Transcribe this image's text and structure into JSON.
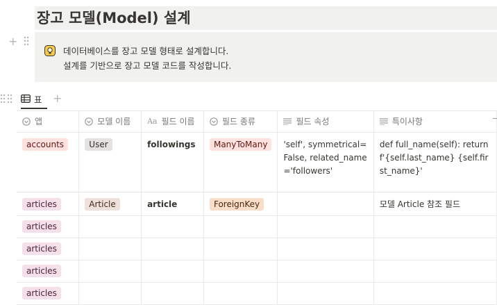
{
  "page": {
    "title": "장고 모델(Model) 설계"
  },
  "callout": {
    "icon": "lightbulb-emoji",
    "line1": "데이터베이스를 장고 모델 형태로 설계합니다.",
    "line2": "설계를 기반으로 장고 모델 코드를 작성합니다."
  },
  "view": {
    "tab_label": "표",
    "add_symbol": "+",
    "block_add_symbol": "+"
  },
  "table": {
    "headers": [
      {
        "label": "앱",
        "icon": "select-icon"
      },
      {
        "label": "모델 이름",
        "icon": "select-icon"
      },
      {
        "label": "필드 이름",
        "icon": "title-icon",
        "prefix": "Aa"
      },
      {
        "label": "필드 종류",
        "icon": "select-icon"
      },
      {
        "label": "필드 속성",
        "icon": "text-icon"
      },
      {
        "label": "특이사항",
        "icon": "text-icon"
      }
    ],
    "rows": [
      {
        "app": "accounts",
        "model": "User",
        "field_name": "followings",
        "field_type": "ManyToMany",
        "field_attr": "'self', symmetrical=False, related_name='followers'",
        "note": "def full_name(self): return f'{self.last_name} {self.first_name}'"
      },
      {
        "app": "articles",
        "model": "Article",
        "field_name": "article",
        "field_type": "ForeignKey",
        "field_attr": "",
        "note": "모델 Article 참조 필드"
      },
      {
        "app": "articles",
        "model": "",
        "field_name": "",
        "field_type": "",
        "field_attr": "",
        "note": ""
      },
      {
        "app": "articles",
        "model": "",
        "field_name": "",
        "field_type": "",
        "field_attr": "",
        "note": ""
      },
      {
        "app": "articles",
        "model": "",
        "field_name": "",
        "field_type": "",
        "field_attr": "",
        "note": ""
      },
      {
        "app": "articles",
        "model": "",
        "field_name": "",
        "field_type": "",
        "field_attr": "",
        "note": ""
      }
    ]
  },
  "colors": {
    "callout_bg": "#f1f1ef",
    "tag_pink": "#f5e0e9",
    "tag_red": "#ffe2dd",
    "tag_gray": "#e3e2e0",
    "tag_brown": "#eee0da",
    "tag_orange": "#fadec9"
  }
}
